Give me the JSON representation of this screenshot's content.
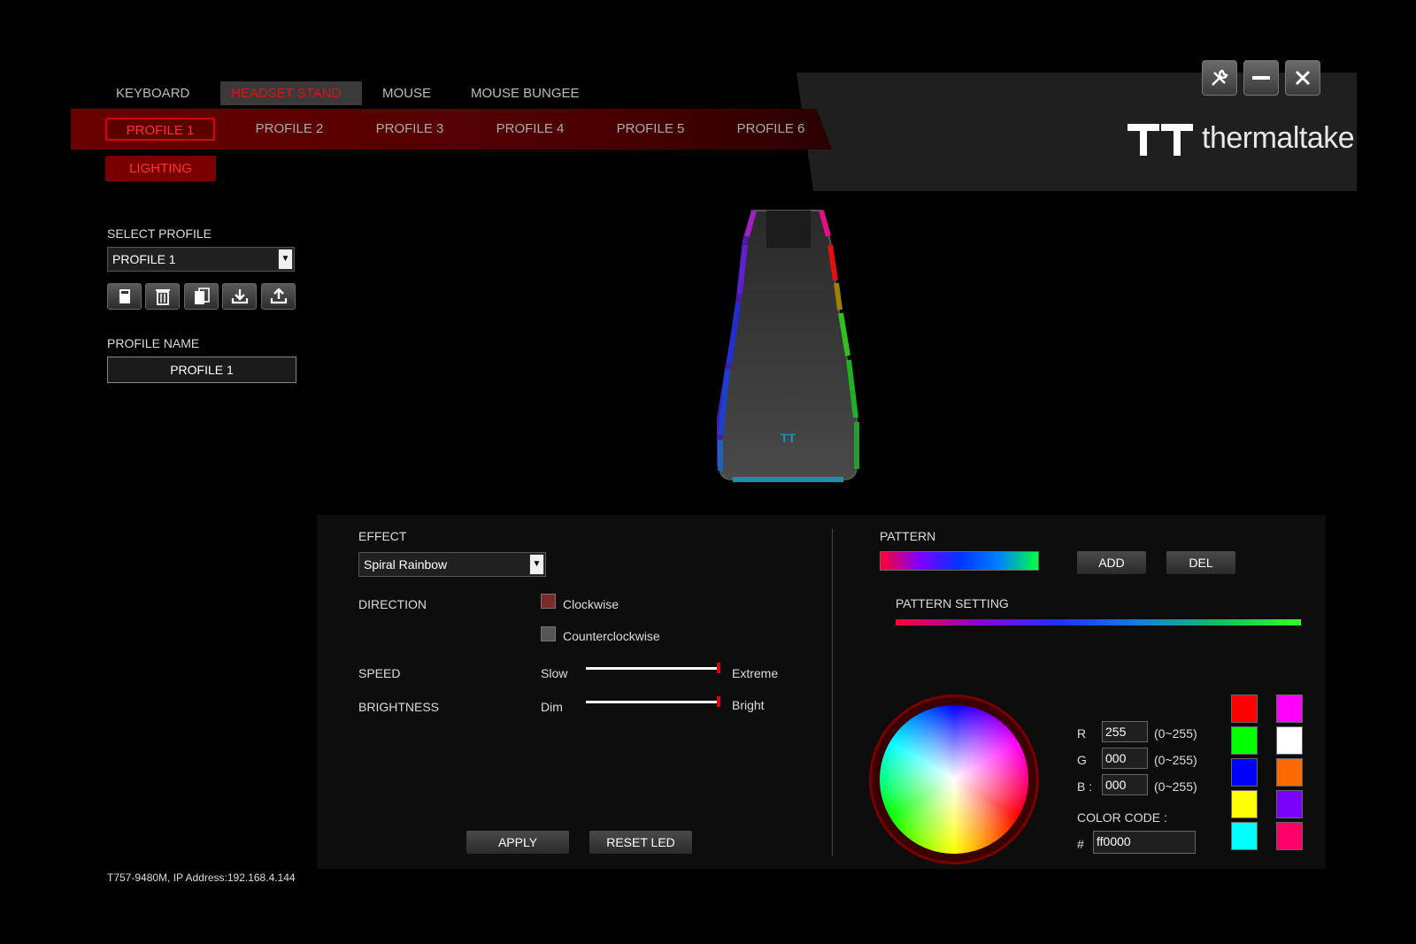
{
  "top_tabs": [
    "KEYBOARD",
    "HEADSET STAND",
    "MOUSE",
    "MOUSE BUNGEE"
  ],
  "active_top_tab": "HEADSET STAND",
  "brand": "thermaltake",
  "profile_tabs": [
    "PROFILE 1",
    "PROFILE 2",
    "PROFILE 3",
    "PROFILE 4",
    "PROFILE 5",
    "PROFILE 6"
  ],
  "lighting_label": "LIGHTING",
  "left": {
    "select_profile_label": "SELECT PROFILE",
    "selected_profile": "PROFILE 1",
    "profile_name_label": "PROFILE NAME",
    "profile_name": "PROFILE 1"
  },
  "effect": {
    "label": "EFFECT",
    "selected": "Spiral Rainbow",
    "direction_label": "DIRECTION",
    "clockwise": "Clockwise",
    "counterclockwise": "Counterclockwise",
    "speed_label": "SPEED",
    "speed_min": "Slow",
    "speed_max": "Extreme",
    "speed_value": 1.0,
    "brightness_label": "BRIGHTNESS",
    "brightness_min": "Dim",
    "brightness_max": "Bright",
    "brightness_value": 1.0,
    "apply": "APPLY",
    "reset": "RESET LED"
  },
  "pattern": {
    "label": "PATTERN",
    "add": "ADD",
    "del": "DEL",
    "setting_label": "PATTERN SETTING"
  },
  "color": {
    "r_label": "R",
    "g_label": "G",
    "b_label": "B :",
    "r": "255",
    "g": "000",
    "b": "000",
    "range": "(0~255)",
    "code_label": "COLOR CODE :",
    "hash": "#",
    "code": "ff0000",
    "swatches": [
      "#ff0000",
      "#ff00ff",
      "#00ff00",
      "#ffffff",
      "#0000ff",
      "#ff6a00",
      "#ffff00",
      "#7a00ff",
      "#00ffff",
      "#ff0066"
    ]
  },
  "footer": "T757-9480M, IP Address:192.168.4.144"
}
